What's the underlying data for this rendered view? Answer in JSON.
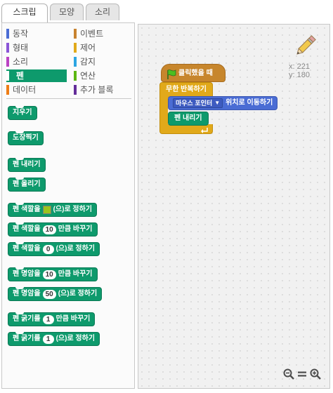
{
  "tabs": [
    {
      "label": "스크립트",
      "active": true
    },
    {
      "label": "모양",
      "active": false
    },
    {
      "label": "소리",
      "active": false
    }
  ],
  "categories": [
    {
      "label": "동작",
      "color": "#4a6cd4"
    },
    {
      "label": "형태",
      "color": "#8a55d7"
    },
    {
      "label": "소리",
      "color": "#bb42c3"
    },
    {
      "label": "펜",
      "color": "#0e9a6c",
      "selected": true
    },
    {
      "label": "데이터",
      "color": "#ee7d16"
    },
    {
      "label": "이벤트",
      "color": "#c88330"
    },
    {
      "label": "제어",
      "color": "#e1a91a"
    },
    {
      "label": "감지",
      "color": "#2ca5e2"
    },
    {
      "label": "연산",
      "color": "#5cb712"
    },
    {
      "label": "추가 블록",
      "color": "#632d99"
    }
  ],
  "palette_blocks": {
    "clear": "지우기",
    "stamp": "도장찍기",
    "pen_down": "펜 내리기",
    "pen_up": "펜 올리기",
    "set_color_pre": "펜 색깔을",
    "set_color_post": "(으)로 정하기",
    "set_color_swatch": "#9bc31e",
    "change_color_pre": "펜 색깔을",
    "change_color_value": "10",
    "change_color_post": "만큼 바꾸기",
    "set_color_num_pre": "펜 색깔을",
    "set_color_num_value": "0",
    "set_color_num_post": "(으)로 정하기",
    "change_shade_pre": "펜 명암을",
    "change_shade_value": "10",
    "change_shade_post": "만큼 바꾸기",
    "set_shade_pre": "펜 명암을",
    "set_shade_value": "50",
    "set_shade_post": "(으)로 정하기",
    "change_size_pre": "펜 굵기를",
    "change_size_value": "1",
    "change_size_post": "만큼 바꾸기",
    "set_size_pre": "펜 굵기를",
    "set_size_value": "1",
    "set_size_post": "(으)로 정하기"
  },
  "script": {
    "hat_label": "클릭했을 때",
    "forever_label": "무한 반복하기",
    "goto_dropdown": "마우스 포인터",
    "goto_post": "위치로 이동하기",
    "pen_down_label": "펜 내리기"
  },
  "sprite_coords": {
    "x_label": "x: 221",
    "y_label": "y: 180"
  },
  "icons": {
    "pencil": "pencil-icon",
    "flag": "green-flag-icon",
    "zoom_out": "zoom-out-icon",
    "zoom_reset": "zoom-reset-icon",
    "zoom_in": "zoom-in-icon"
  }
}
